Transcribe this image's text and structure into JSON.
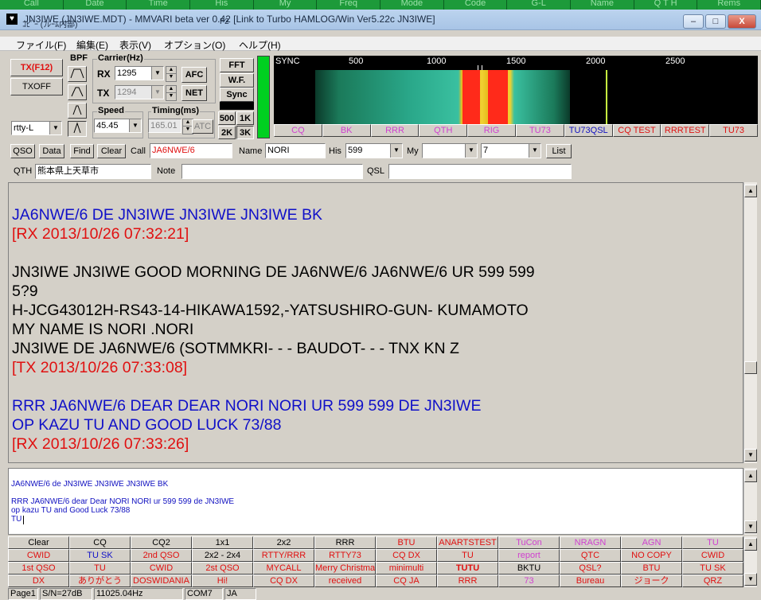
{
  "top_strip": [
    "Call",
    "Date",
    "Time",
    "His",
    "My",
    "Freq",
    "Mode",
    "Code",
    "G-L",
    "Name",
    "Q T H",
    "Rems"
  ],
  "window": {
    "title": "JN3IWE (JN3IWE.MDT) - MMVARI beta ver 0.42 [Link to Turbo HAMLOG/Win Ver5.22c JN3IWE]",
    "subtitle": "ｺﾋﾟｰ (ﾌﾚｰﾑ内部)",
    "subtitle_key": "F2",
    "minimize": "–",
    "maximize": "□",
    "close": "X",
    "icon": "♥"
  },
  "menu": [
    "ファイル(F)",
    "編集(E)",
    "表示(V)",
    "オプション(O)",
    "ヘルプ(H)"
  ],
  "controls": {
    "tx": "TX(F12)",
    "txoff": "TXOFF",
    "bpf": "BPF",
    "carrier_label": "Carrier(Hz)",
    "rx_label": "RX",
    "rx_value": "1295",
    "tx_label": "TX",
    "tx_value": "1294",
    "afc": "AFC",
    "net": "NET",
    "fft": "FFT",
    "wf": "W.F.",
    "sync": "Sync",
    "speed_label": "Speed",
    "speed_value": "45.45",
    "timing_label": "Timing(ms)",
    "timing_value": "165.01",
    "atc": "ATC",
    "mode": "rtty-L",
    "span_500": "500",
    "span_1k": "1K",
    "span_2k": "2K",
    "span_3k": "3K"
  },
  "waterfall": {
    "sync_label": "SYNC",
    "ticks": [
      "500",
      "1000",
      "1500",
      "2000",
      "2500"
    ]
  },
  "wf_macros": [
    {
      "label": "CQ",
      "color": "#d040d0"
    },
    {
      "label": "BK",
      "color": "#d040d0"
    },
    {
      "label": "RRR",
      "color": "#d040d0"
    },
    {
      "label": "QTH",
      "color": "#d040d0"
    },
    {
      "label": "RIG",
      "color": "#d040d0"
    },
    {
      "label": "TU73",
      "color": "#d040d0"
    },
    {
      "label": "TU73QSL",
      "color": "#1010c0"
    },
    {
      "label": "CQ TEST",
      "color": "#e01010"
    },
    {
      "label": "RRRTEST",
      "color": "#e01010"
    },
    {
      "label": "TU73",
      "color": "#e01010"
    }
  ],
  "log": {
    "qso": "QSO",
    "data": "Data",
    "find": "Find",
    "clear": "Clear",
    "call_label": "Call",
    "call_value": "JA6NWE/6",
    "name_label": "Name",
    "name_value": "NORI",
    "his_label": "His",
    "his_value": "599",
    "my_label": "My",
    "my_value": "",
    "extra_value": "7",
    "list": "List",
    "qth_label": "QTH",
    "qth_value": "熊本県上天草市",
    "note_label": "Note",
    "note_value": "",
    "qsl_label": "QSL",
    "qsl_value": ""
  },
  "rx_lines": [
    {
      "text": "JA6NWE/6 DE JN3IWE JN3IWE JN3IWE BK",
      "color": "#1010c8"
    },
    {
      "text": "[RX 2013/10/26 07:32:21]",
      "color": "#e01010"
    },
    {
      "text": "",
      "color": "#000"
    },
    {
      "text": " JN3IWE JN3IWE GOOD MORNING DE JA6NWE/6 JA6NWE/6 UR 599 599",
      "color": "#000"
    },
    {
      "text": "5?9",
      "color": "#000"
    },
    {
      "text": "H-JCG43012H-RS43-14-HIKAWA1592,-YATSUSHIRO-GUN- KUMAMOTO",
      "color": "#000"
    },
    {
      "text": "MY NAME IS NORI .NORI",
      "color": "#000"
    },
    {
      "text": "JN3IWE DE JA6NWE/6 (SOTMMKRI- - - BAUDOT- - - TNX KN Z",
      "color": "#000"
    },
    {
      "text": "[TX 2013/10/26 07:33:08]",
      "color": "#e01010"
    },
    {
      "text": "",
      "color": "#000"
    },
    {
      "text": "RRR JA6NWE/6 DEAR DEAR NORI NORI UR 599 599 DE JN3IWE",
      "color": "#1010c8"
    },
    {
      "text": "OP KAZU TU AND GOOD LUCK 73/88",
      "color": "#1010c8"
    },
    {
      "text": "[RX 2013/10/26 07:33:26]",
      "color": "#e01010"
    }
  ],
  "tx_lines": [
    "JA6NWE/6 de JN3IWE JN3IWE JN3IWE BK",
    "",
    "RRR JA6NWE/6 dear Dear NORI NORI ur 599 599 de JN3IWE",
    "op kazu TU and Good Luck 73/88",
    "TU"
  ],
  "macros": [
    [
      {
        "t": "Clear",
        "c": "#000"
      },
      {
        "t": "CQ",
        "c": "#000"
      },
      {
        "t": "CQ2",
        "c": "#000"
      },
      {
        "t": "1x1",
        "c": "#000"
      },
      {
        "t": "2x2",
        "c": "#000"
      },
      {
        "t": "RRR",
        "c": "#000"
      },
      {
        "t": "BTU",
        "c": "#e01010"
      },
      {
        "t": "ANARTSTEST",
        "c": "#e01010"
      },
      {
        "t": "TuCon",
        "c": "#d040d0"
      },
      {
        "t": "NRAGN",
        "c": "#d040d0"
      },
      {
        "t": "AGN",
        "c": "#d040d0"
      },
      {
        "t": "TU",
        "c": "#d040d0"
      }
    ],
    [
      {
        "t": "CWID",
        "c": "#e01010"
      },
      {
        "t": "TU SK",
        "c": "#1010c8"
      },
      {
        "t": "2nd QSO",
        "c": "#e01010"
      },
      {
        "t": "2x2 - 2x4",
        "c": "#000"
      },
      {
        "t": "RTTY/RRR",
        "c": "#e01010"
      },
      {
        "t": "RTTY73",
        "c": "#e01010"
      },
      {
        "t": "CQ DX",
        "c": "#e01010"
      },
      {
        "t": "TU",
        "c": "#e01010"
      },
      {
        "t": "report",
        "c": "#d040d0"
      },
      {
        "t": "QTC",
        "c": "#e01010"
      },
      {
        "t": "NO COPY",
        "c": "#e01010"
      },
      {
        "t": "CWID",
        "c": "#e01010"
      }
    ],
    [
      {
        "t": "1st QSO",
        "c": "#e01010"
      },
      {
        "t": "TU",
        "c": "#e01010"
      },
      {
        "t": "CWID",
        "c": "#e01010"
      },
      {
        "t": "2st QSO",
        "c": "#e01010"
      },
      {
        "t": "MYCALL",
        "c": "#e01010"
      },
      {
        "t": "Merry Christmas",
        "c": "#e01010"
      },
      {
        "t": "minimulti",
        "c": "#e01010"
      },
      {
        "t": "TUTU",
        "c": "#e01010"
      },
      {
        "t": "BKTU",
        "c": "#000"
      },
      {
        "t": "QSL?",
        "c": "#e01010"
      },
      {
        "t": "BTU",
        "c": "#e01010"
      },
      {
        "t": "TU SK",
        "c": "#e01010"
      }
    ],
    [
      {
        "t": "DX",
        "c": "#e01010"
      },
      {
        "t": "ありがとう",
        "c": "#e01010"
      },
      {
        "t": "DOSWIDANIA",
        "c": "#e01010"
      },
      {
        "t": "Hi!",
        "c": "#e01010"
      },
      {
        "t": "CQ DX",
        "c": "#e01010"
      },
      {
        "t": "received",
        "c": "#e01010"
      },
      {
        "t": "CQ JA",
        "c": "#e01010"
      },
      {
        "t": "RRR",
        "c": "#e01010"
      },
      {
        "t": "73",
        "c": "#d040d0"
      },
      {
        "t": "Bureau",
        "c": "#e01010"
      },
      {
        "t": "ジョーク",
        "c": "#e01010"
      },
      {
        "t": "QRZ",
        "c": "#e01010"
      }
    ]
  ],
  "status": {
    "page": "Page1",
    "sn": "S/N=27dB",
    "freq": "11025.04Hz",
    "port": "COM7",
    "lang": "JA"
  }
}
